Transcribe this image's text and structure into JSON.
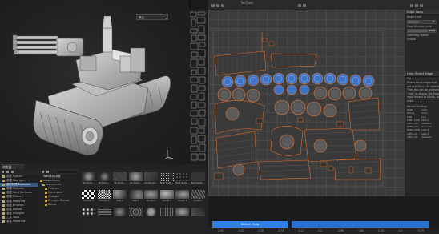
{
  "uv_window": {
    "title": "TexTools"
  },
  "viewport": {
    "shading_mode": "默认"
  },
  "browser": {
    "tab_label": "浏览器",
    "tree_items": [
      {
        "label": "收藏 Python",
        "selected": false
      },
      {
        "label": "收藏 Shortgen",
        "selected": false
      },
      {
        "label": "我的材质 Materials",
        "selected": true
      },
      {
        "label": "收藏 Textures",
        "selected": false
      },
      {
        "label": "收藏 Hard Surfaces",
        "selected": false
      },
      {
        "label": "收藏 Filters",
        "selected": false
      },
      {
        "label": "收藏 Materials",
        "selected": false
      },
      {
        "label": "收藏 Brushes",
        "selected": false
      },
      {
        "label": "收藏 Alphas",
        "selected": false
      },
      {
        "label": "收藏 Grunges",
        "selected": false
      },
      {
        "label": "工具 Tools",
        "selected": false
      },
      {
        "label": "收藏 Materials",
        "selected": false
      }
    ],
    "folder_header": "Tools 材质预设",
    "folder_items": [
      "allegorithmic",
      "procedurals",
      "Particles",
      "Generators",
      "Grunges",
      "Grunges Bitmap",
      "Noises"
    ],
    "thumbnails": [
      {
        "label": "3D Perlin..."
      },
      {
        "label": "3D Perlin..."
      },
      {
        "label": "3D Perlin..."
      },
      {
        "label": "3D Simpl..."
      },
      {
        "label": "Anisotropic..."
      },
      {
        "label": "BnW Spots..."
      },
      {
        "label": "BnW Spots..."
      },
      {
        "label": "BnW Spots..."
      },
      {
        "label": "Checker 1"
      },
      {
        "label": "Checker 2"
      },
      {
        "label": "Cells 1"
      },
      {
        "label": "Cells 2"
      },
      {
        "label": "Clouds 1"
      },
      {
        "label": "Clouds 2"
      },
      {
        "label": "Clouds 3"
      },
      {
        "label": "Crystal 1"
      },
      {
        "label": ""
      },
      {
        "label": ""
      },
      {
        "label": ""
      },
      {
        "label": ""
      },
      {
        "label": ""
      },
      {
        "label": ""
      },
      {
        "label": ""
      },
      {
        "label": ""
      }
    ]
  },
  "right_panel": {
    "edge_loop": {
      "title": "Edge Loop",
      "rows": [
        {
          "label": "Angle Limit",
          "value": "40"
        },
        {
          "label": "Edge Number Limit",
          "value": "9999"
        },
        {
          "label": "Geometry Based",
          "value": ""
        },
        {
          "label": "Enable",
          "value": ""
        }
      ]
    },
    "help": {
      "title": "Help Select Edge",
      "tip_title": "Tip",
      "tip_lines": [
        "Select some edges then",
        "set and Ctrl+C for selection.",
        "Then this will be uniformed",
        "\"Add\" to display the Edge",
        "rapid access to rotate, pan",
        "scale."
      ],
      "bindings_title": "Mouse Bindings",
      "bindings": [
        [
          "RMB",
          "orbit"
        ],
        [
          "Wheel",
          "zoom"
        ],
        [
          "LMB",
          "pan"
        ],
        [
          "LMB+Shift",
          "select"
        ],
        [
          "LMB+Ctrl",
          "deselect"
        ],
        [
          "RMB+Ctrl",
          "deselect"
        ],
        [
          "RMB+Shift",
          "select"
        ],
        [
          "LMB+Alt",
          "select"
        ],
        [
          "LMB+Alt",
          "deselect"
        ]
      ]
    }
  },
  "uv_bottom": {
    "button_label": "Sketch Help",
    "ruler_ticks": [
      "2.65",
      "3.02",
      "2.30",
      "2.75",
      "4.12",
      "4.2",
      "2.96",
      "1.88",
      "2.26",
      "4.0",
      "5.75"
    ]
  },
  "colors": {
    "accent": "#2f7fe6",
    "uv_orange": "#e8702a",
    "uv_blue": "#3d74c8",
    "selected_bg": "#3b5a83"
  }
}
